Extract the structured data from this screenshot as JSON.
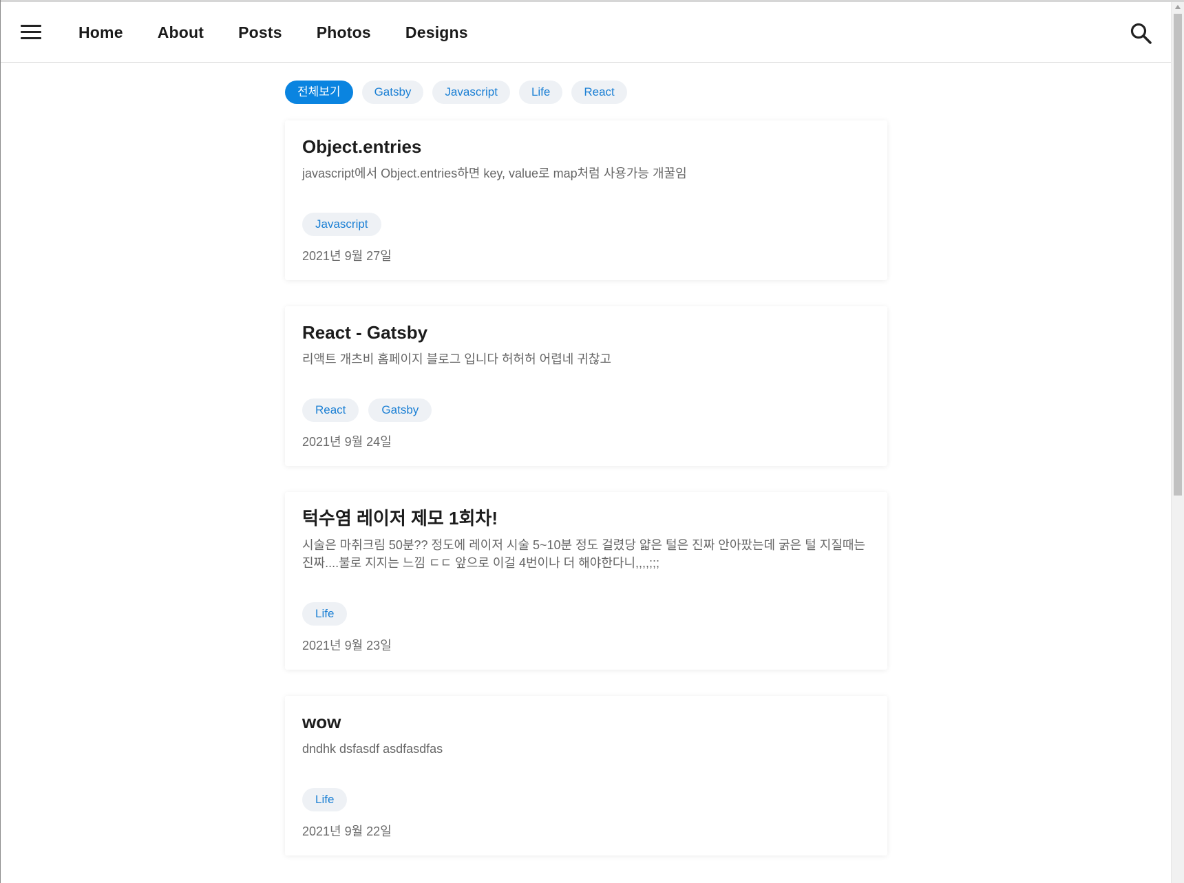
{
  "header": {
    "nav": [
      "Home",
      "About",
      "Posts",
      "Photos",
      "Designs"
    ]
  },
  "categories": {
    "active": "전체보기",
    "items": [
      "전체보기",
      "Gatsby",
      "Javascript",
      "Life",
      "React"
    ]
  },
  "posts": [
    {
      "title": "Object.entries",
      "summary": "javascript에서 Object.entries하면 key, value로 map처럼 사용가능 개꿀임",
      "tags": [
        "Javascript"
      ],
      "date": "2021년 9월 27일"
    },
    {
      "title": "React - Gatsby",
      "summary": "리액트 개츠비 홈페이지 블로그 입니다 허허허 어렵네 귀찮고",
      "tags": [
        "React",
        "Gatsby"
      ],
      "date": "2021년 9월 24일"
    },
    {
      "title": "턱수염 레이저 제모 1회차!",
      "summary": "시술은 마취크림 50분?? 정도에 레이저 시술 5~10분 정도 걸렸당 얇은 털은 진짜 안아팠는데 굵은 털 지질때는 진짜....불로 지지는 느낌 ㄷㄷ 앞으로 이걸 4번이나 더 해야한다니,,,,;;;",
      "tags": [
        "Life"
      ],
      "date": "2021년 9월 23일"
    },
    {
      "title": "wow",
      "summary": "dndhk dsfasdf asdfasdfas",
      "tags": [
        "Life"
      ],
      "date": "2021년 9월 22일"
    }
  ],
  "colors": {
    "accent": "#0a84e0",
    "chip_bg": "#eef1f5",
    "chip_text": "#1a7fd4"
  },
  "icons": {
    "menu": "hamburger-menu-icon",
    "search": "search-icon"
  }
}
